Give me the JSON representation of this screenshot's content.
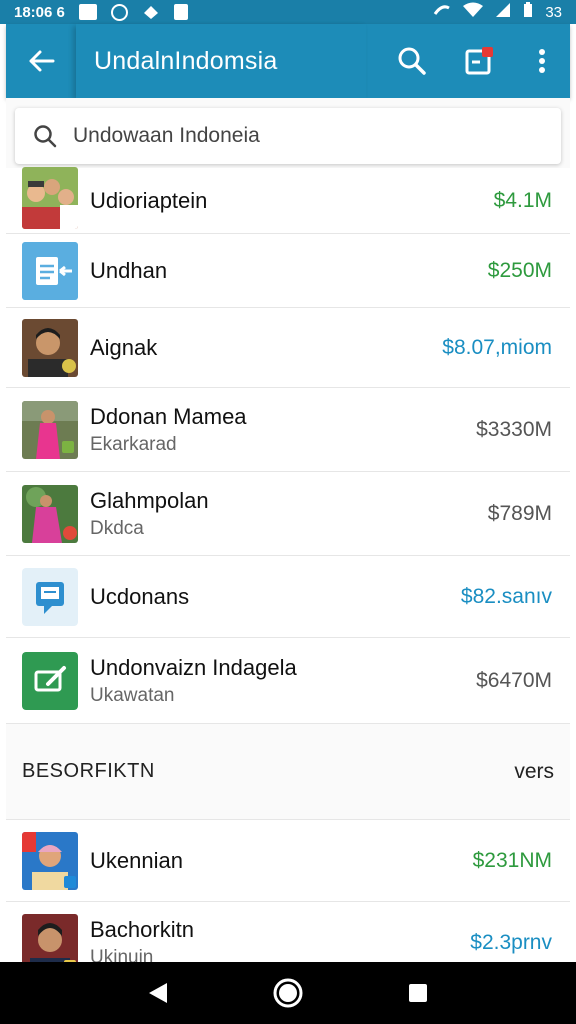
{
  "status_bar": {
    "time": "18:06 6",
    "battery": "33"
  },
  "app_bar": {
    "title": "UndalnIndomsia"
  },
  "search": {
    "text": "Undowaan Indoneia"
  },
  "items": [
    {
      "name": "Udioriaptein",
      "sub": "",
      "value": "$4.1M"
    },
    {
      "name": "Undhan",
      "sub": "",
      "value": "$250M"
    },
    {
      "name": "Aignak",
      "sub": "",
      "value": "$8.07,miom"
    },
    {
      "name": "Ddonan Mamea",
      "sub": "Ekarkarad",
      "value": "$3330M"
    },
    {
      "name": "Glahmpolan",
      "sub": "Dkdca",
      "value": "$789M"
    },
    {
      "name": "Ucdonans",
      "sub": "",
      "value": "$82.sanıv"
    },
    {
      "name": "Undonvaizn Indagela",
      "sub": "Ukawatan",
      "value": "$6470M"
    }
  ],
  "section": {
    "header": "BESORFIKTN",
    "link": "vers"
  },
  "items2": [
    {
      "name": "Ukennian",
      "sub": "",
      "value": "$231NM"
    },
    {
      "name": "Bachorkitn",
      "sub": "Ukinuin",
      "value": "$2.3prnv"
    }
  ],
  "colors": {
    "status_bar": "#1a7fa8",
    "app_bar": "#1d8cb8",
    "green_value": "#2e9a3e",
    "blue_value": "#1a8ec2"
  }
}
